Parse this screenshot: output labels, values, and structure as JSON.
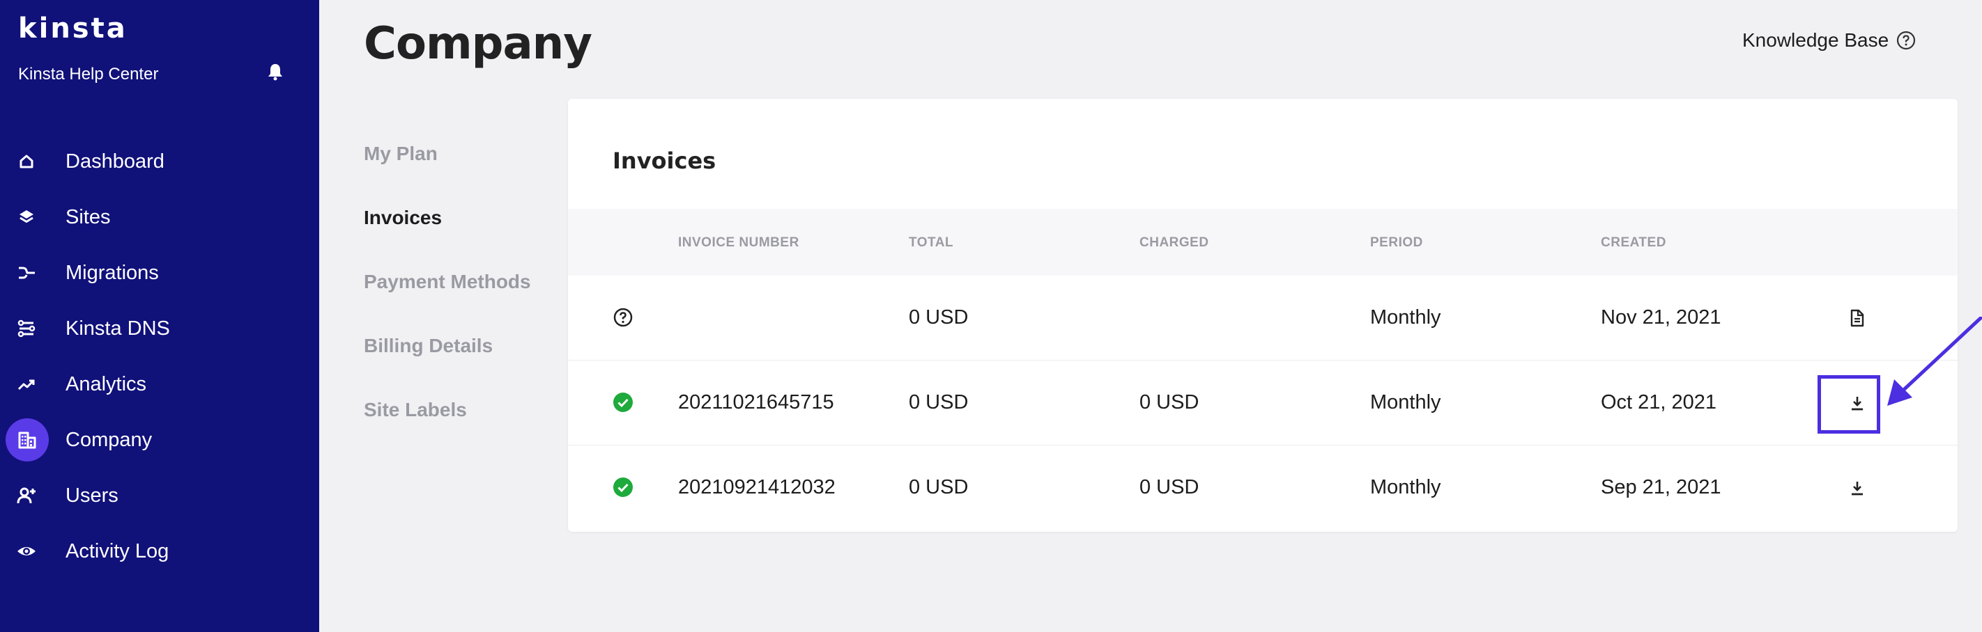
{
  "sidebar": {
    "logo": "kinsta",
    "help_center": "Kinsta Help Center",
    "items": [
      {
        "label": "Dashboard",
        "icon": "home-icon",
        "active": false
      },
      {
        "label": "Sites",
        "icon": "layers-icon",
        "active": false
      },
      {
        "label": "Migrations",
        "icon": "migrations-icon",
        "active": false
      },
      {
        "label": "Kinsta DNS",
        "icon": "dns-icon",
        "active": false
      },
      {
        "label": "Analytics",
        "icon": "trend-icon",
        "active": false
      },
      {
        "label": "Company",
        "icon": "building-icon",
        "active": true
      },
      {
        "label": "Users",
        "icon": "add-user-icon",
        "active": false
      },
      {
        "label": "Activity Log",
        "icon": "eye-icon",
        "active": false
      }
    ]
  },
  "header": {
    "title": "Company",
    "knowledge_base": "Knowledge Base"
  },
  "subnav": {
    "items": [
      {
        "label": "My Plan",
        "active": false
      },
      {
        "label": "Invoices",
        "active": true
      },
      {
        "label": "Payment Methods",
        "active": false
      },
      {
        "label": "Billing Details",
        "active": false
      },
      {
        "label": "Site Labels",
        "active": false
      }
    ]
  },
  "invoices": {
    "title": "Invoices",
    "columns": [
      "INVOICE NUMBER",
      "TOTAL",
      "CHARGED",
      "PERIOD",
      "CREATED"
    ],
    "rows": [
      {
        "status": "unknown",
        "number": "",
        "total": "0 USD",
        "charged": "",
        "period": "Monthly",
        "created": "Nov 21, 2021",
        "action": "document-icon"
      },
      {
        "status": "paid",
        "number": "20211021645715",
        "total": "0 USD",
        "charged": "0 USD",
        "period": "Monthly",
        "created": "Oct 21, 2021",
        "action": "download-icon"
      },
      {
        "status": "paid",
        "number": "20210921412032",
        "total": "0 USD",
        "charged": "0 USD",
        "period": "Monthly",
        "created": "Sep 21, 2021",
        "action": "download-icon"
      }
    ]
  },
  "colors": {
    "sidebar_bg": "#11117a",
    "accent": "#5a3be8",
    "highlight": "#4b2fe0",
    "success": "#1eaa3c"
  }
}
